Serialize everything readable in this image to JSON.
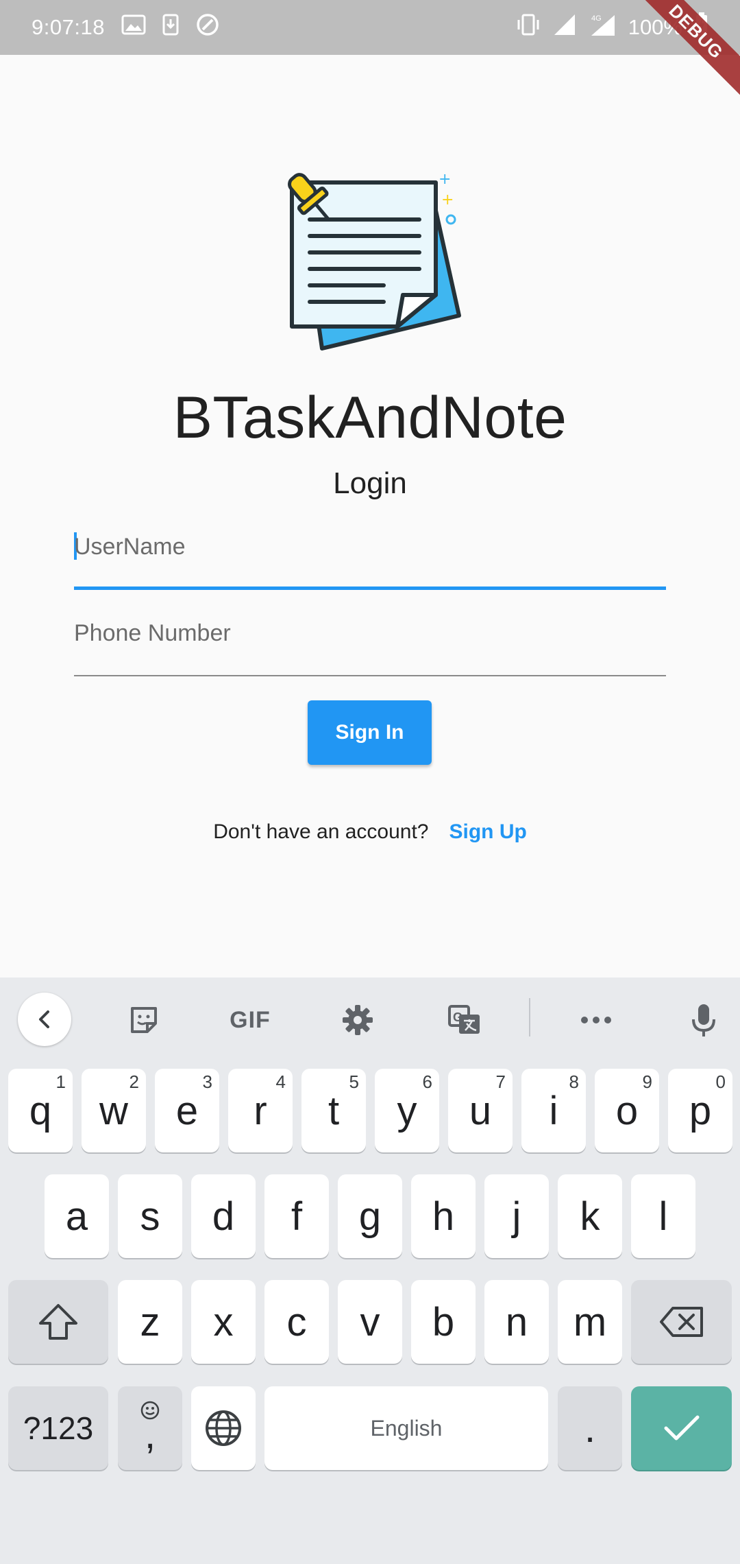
{
  "status_bar": {
    "time": "9:07:18",
    "battery": "100%",
    "network": "4G"
  },
  "debug_banner": "DEBUG",
  "app": {
    "title": "BTaskAndNote",
    "subtitle": "Login",
    "username_placeholder": "UserName",
    "phone_placeholder": "Phone Number",
    "signin_label": "Sign In",
    "no_account_text": "Don't have an account?",
    "signup_label": "Sign Up",
    "accent_color": "#2196f3"
  },
  "keyboard": {
    "toolbar": [
      "back-icon",
      "sticker-icon",
      "gif-icon",
      "settings-icon",
      "translate-icon",
      "more-icon",
      "mic-icon"
    ],
    "gif_label": "GIF",
    "row1": [
      {
        "k": "q",
        "n": "1"
      },
      {
        "k": "w",
        "n": "2"
      },
      {
        "k": "e",
        "n": "3"
      },
      {
        "k": "r",
        "n": "4"
      },
      {
        "k": "t",
        "n": "5"
      },
      {
        "k": "y",
        "n": "6"
      },
      {
        "k": "u",
        "n": "7"
      },
      {
        "k": "i",
        "n": "8"
      },
      {
        "k": "o",
        "n": "9"
      },
      {
        "k": "p",
        "n": "0"
      }
    ],
    "row2": [
      "a",
      "s",
      "d",
      "f",
      "g",
      "h",
      "j",
      "k",
      "l"
    ],
    "row3": [
      "z",
      "x",
      "c",
      "v",
      "b",
      "n",
      "m"
    ],
    "symbols_label": "?123",
    "comma_label": ",",
    "space_label": "English",
    "period_label": ".",
    "enter_color": "#5bb3a5"
  }
}
